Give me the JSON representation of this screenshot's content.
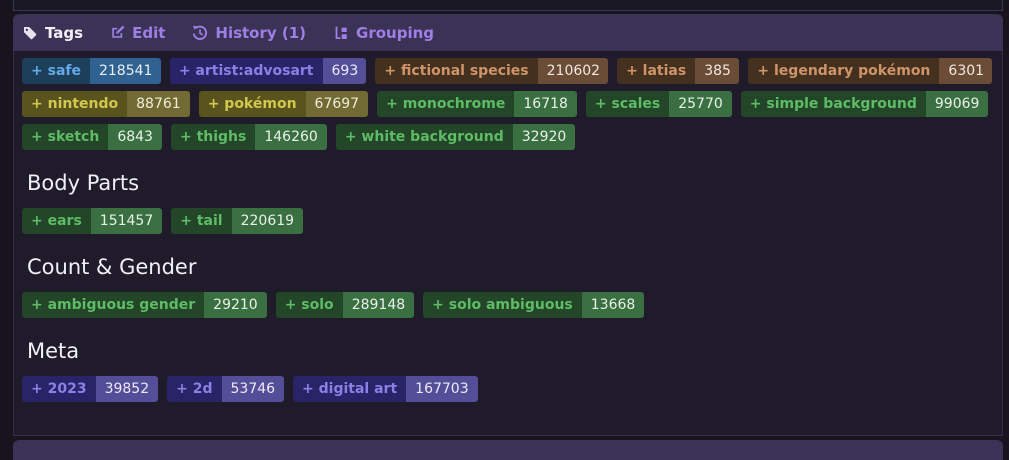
{
  "toolbar": {
    "items": [
      {
        "label": "Tags",
        "icon": "tag-icon",
        "active": true
      },
      {
        "label": "Edit",
        "icon": "edit-icon",
        "active": false
      },
      {
        "label": "History (1)",
        "icon": "history-icon",
        "active": false
      },
      {
        "label": "Grouping",
        "icon": "grouping-icon",
        "active": false
      }
    ]
  },
  "plus_prefix": "+",
  "category_colors": {
    "rating": {
      "name_bg": "#1c4059",
      "name_text": "#64a8e8",
      "count_bg": "#2f6290",
      "count_text": "#e9eef5"
    },
    "artist": {
      "name_bg": "#292367",
      "name_text": "#8a80e6",
      "count_bg": "#544e99",
      "count_text": "#eceaf6"
    },
    "species": {
      "name_bg": "#44301e",
      "name_text": "#cf9469",
      "count_bg": "#6b4c36",
      "count_text": "#f0e8e0"
    },
    "copyright": {
      "name_bg": "#59531e",
      "name_text": "#d2c84e",
      "count_bg": "#716b33",
      "count_text": "#efecda"
    },
    "general": {
      "name_bg": "#234528",
      "name_text": "#5ebc66",
      "count_bg": "#3a6f41",
      "count_text": "#e9f1e9"
    },
    "meta": {
      "name_bg": "#292367",
      "name_text": "#8a80e6",
      "count_bg": "#544e99",
      "count_text": "#eceaf6"
    }
  },
  "tag_sections": [
    {
      "heading": "",
      "rows": [
        [
          {
            "name": "safe",
            "count": "218541",
            "category": "rating"
          },
          {
            "name": "artist:advosart",
            "count": "693",
            "category": "artist"
          },
          {
            "name": "fictional species",
            "count": "210602",
            "category": "species"
          },
          {
            "name": "latias",
            "count": "385",
            "category": "species"
          },
          {
            "name": "legendary pokémon",
            "count": "6301",
            "category": "species"
          }
        ],
        [
          {
            "name": "nintendo",
            "count": "88761",
            "category": "copyright"
          },
          {
            "name": "pokémon",
            "count": "67697",
            "category": "copyright"
          },
          {
            "name": "monochrome",
            "count": "16718",
            "category": "general"
          },
          {
            "name": "scales",
            "count": "25770",
            "category": "general"
          },
          {
            "name": "simple background",
            "count": "99069",
            "category": "general"
          }
        ],
        [
          {
            "name": "sketch",
            "count": "6843",
            "category": "general"
          },
          {
            "name": "thighs",
            "count": "146260",
            "category": "general"
          },
          {
            "name": "white background",
            "count": "32920",
            "category": "general"
          }
        ]
      ]
    },
    {
      "heading": "Body Parts",
      "rows": [
        [
          {
            "name": "ears",
            "count": "151457",
            "category": "general"
          },
          {
            "name": "tail",
            "count": "220619",
            "category": "general"
          }
        ]
      ]
    },
    {
      "heading": "Count & Gender",
      "rows": [
        [
          {
            "name": "ambiguous gender",
            "count": "29210",
            "category": "general"
          },
          {
            "name": "solo",
            "count": "289148",
            "category": "general"
          },
          {
            "name": "solo ambiguous",
            "count": "13668",
            "category": "general"
          }
        ]
      ]
    },
    {
      "heading": "Meta",
      "rows": [
        [
          {
            "name": "2023",
            "count": "39852",
            "category": "meta"
          },
          {
            "name": "2d",
            "count": "53746",
            "category": "meta"
          },
          {
            "name": "digital art",
            "count": "167703",
            "category": "meta"
          }
        ]
      ]
    }
  ]
}
